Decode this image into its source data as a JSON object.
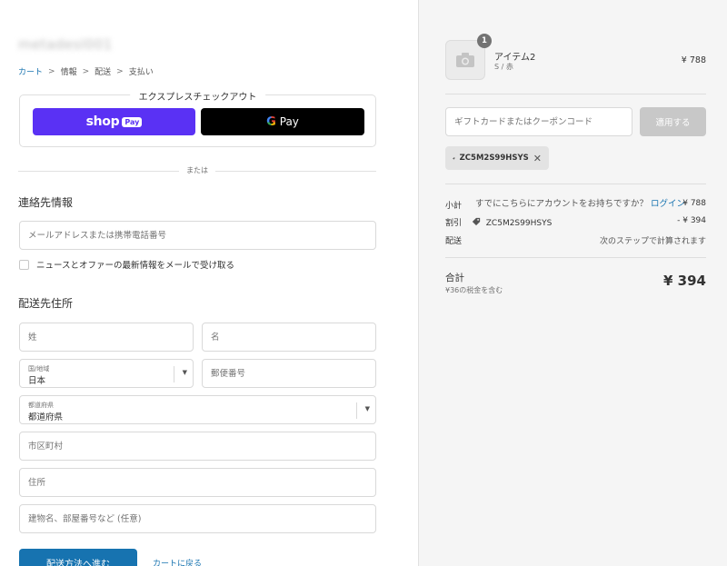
{
  "store": {
    "name": "metadesl001"
  },
  "breadcrumb": [
    {
      "label": "カート",
      "active": true
    },
    {
      "label": "情報",
      "active": false
    },
    {
      "label": "配送",
      "active": false
    },
    {
      "label": "支払い",
      "active": false
    }
  ],
  "breadcrumb_sep": ">",
  "express": {
    "title": "エクスプレスチェックアウト",
    "shop_word": "shop",
    "shop_pay": "Pay",
    "g_letter": "G",
    "gpay_word": "Pay"
  },
  "or_text": "または",
  "contact": {
    "heading": "連絡先情報",
    "account_prompt": "すでにこちらにアカウントをお持ちですか？",
    "login_label": "ログイン",
    "email_placeholder": "メールアドレスまたは携帯電話番号",
    "newsletter_label": "ニュースとオファーの最新情報をメールで受け取る"
  },
  "shipping": {
    "heading": "配送先住所",
    "last_name_placeholder": "姓",
    "first_name_placeholder": "名",
    "country_label": "国/地域",
    "country_value": "日本",
    "postal_placeholder": "郵便番号",
    "prefecture_label": "都道府県",
    "prefecture_value": "都道府県",
    "city_placeholder": "市区町村",
    "address_placeholder": "住所",
    "building_placeholder": "建物名、部屋番号など (任意)"
  },
  "cta": {
    "label": "配送方法へ進む",
    "return_label": "カートに戻る"
  },
  "order": {
    "item": {
      "name": "アイテム2",
      "variant": "S / 赤",
      "price": "¥ 788",
      "qty": "1"
    },
    "gift_placeholder": "ギフトカードまたはクーポンコード",
    "apply_label": "適用する",
    "coupon_code": "ZC5M2S99HSYS",
    "subtotal_label": "小計",
    "subtotal_value": "¥ 788",
    "discount_label": "割引",
    "discount_code": "ZC5M2S99HSYS",
    "discount_value": "- ¥ 394",
    "shipping_label": "配送",
    "shipping_value": "次のステップで計算されます",
    "total_label": "合計",
    "total_tax": "¥36の税金を含む",
    "total_value": "¥ 394"
  },
  "colors": {
    "accent": "#1773b0",
    "shop_pay": "#5a31f4",
    "sidebar_bg": "#f5f5f5"
  }
}
